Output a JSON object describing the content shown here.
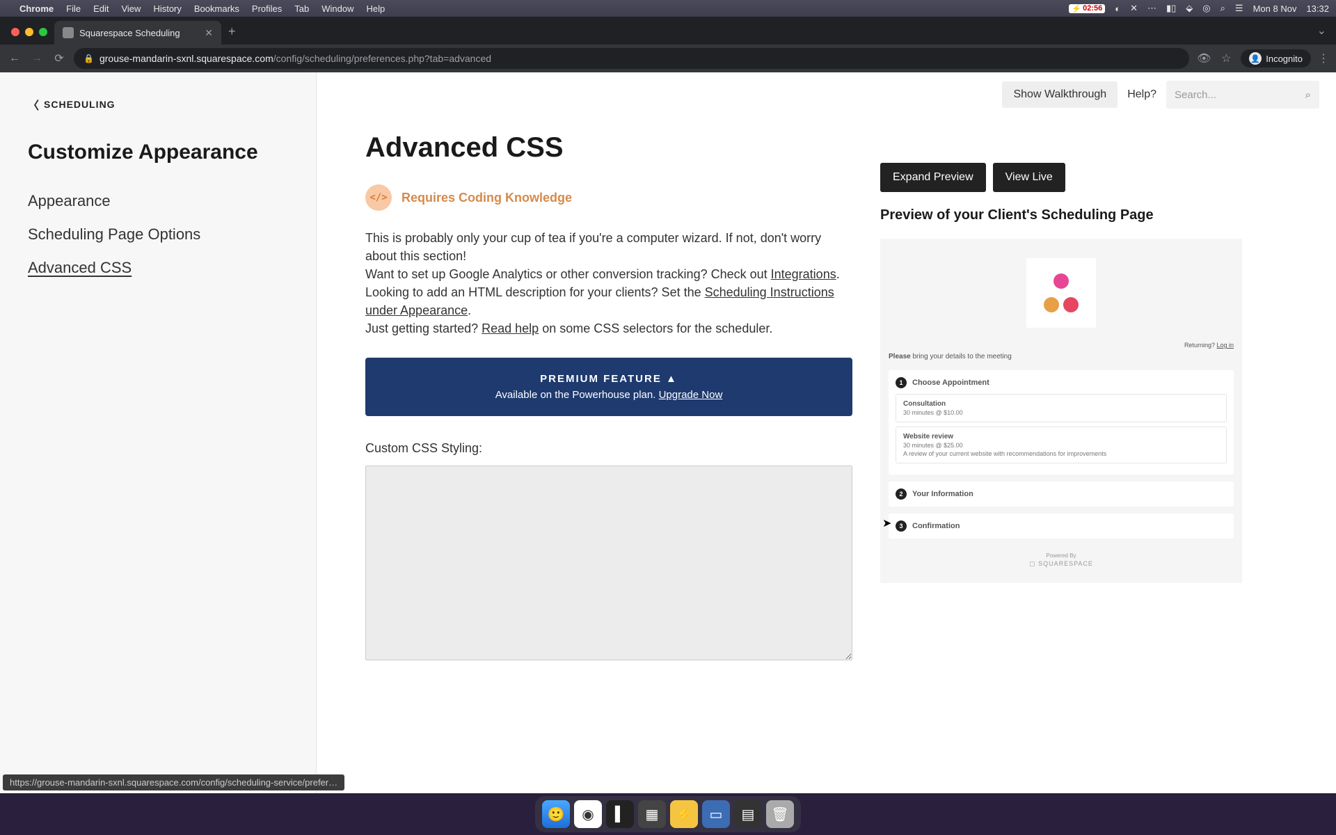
{
  "menubar": {
    "app": "Chrome",
    "items": [
      "File",
      "Edit",
      "View",
      "History",
      "Bookmarks",
      "Profiles",
      "Tab",
      "Window",
      "Help"
    ],
    "battery": "02:56",
    "date": "Mon 8 Nov",
    "time": "13:32"
  },
  "browser": {
    "tab_title": "Squarespace Scheduling",
    "url_domain": "grouse-mandarin-sxnl.squarespace.com",
    "url_path": "/config/scheduling/preferences.php?tab=advanced",
    "incognito": "Incognito",
    "status_url": "https://grouse-mandarin-sxnl.squarespace.com/config/scheduling-service/prefer…"
  },
  "sidebar": {
    "back": "SCHEDULING",
    "title": "Customize Appearance",
    "items": [
      "Appearance",
      "Scheduling Page Options",
      "Advanced CSS"
    ],
    "active_index": 2
  },
  "topbar": {
    "walkthrough": "Show Walkthrough",
    "help": "Help?",
    "search_placeholder": "Search..."
  },
  "main": {
    "heading": "Advanced CSS",
    "warn_label": "Requires Coding Knowledge",
    "p1a": "This is probably only your cup of tea if you're a computer wizard. If not, don't worry about this section!",
    "p2a": "Want to set up Google Analytics or other conversion tracking? Check out ",
    "p2link": "Integrations",
    "p3a": "Looking to add an HTML description for your clients? Set the ",
    "p3link": "Scheduling Instructions under Appearance",
    "p4a": "Just getting started? ",
    "p4link": "Read help",
    "p4b": " on some CSS selectors for the scheduler.",
    "premium_title": "PREMIUM FEATURE ▲",
    "premium_sub": "Available on the Powerhouse plan. ",
    "premium_link": "Upgrade Now",
    "css_label": "Custom CSS Styling:"
  },
  "preview": {
    "expand": "Expand Preview",
    "live": "View Live",
    "title": "Preview of your Client's Scheduling Page",
    "returning": "Returning? ",
    "login": "Log in",
    "instr_bold": "Please",
    "instr_rest": " bring your details to the meeting",
    "step1": "Choose Appointment",
    "step2": "Your Information",
    "step3": "Confirmation",
    "card1_title": "Consultation",
    "card1_sub": "30 minutes @ $10.00",
    "card2_title": "Website review",
    "card2_sub": "30 minutes @ $25.00",
    "card2_desc": "A review of your current website with recommendations for improvements",
    "powered": "Powered By",
    "brand": "▢ SQUARESPACE"
  }
}
